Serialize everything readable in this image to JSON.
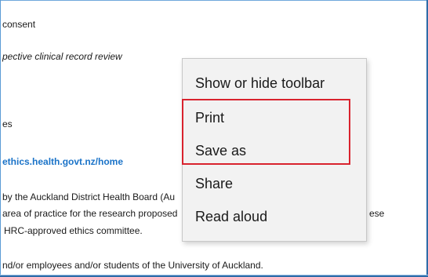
{
  "document": {
    "lines": [
      "consent",
      "pective clinical record review",
      "es",
      "ethics.health.govt.nz/home",
      "by the Auckland District Health Board (Au",
      "area of practice for the research proposed",
      "ese",
      "HRC-approved ethics committee.",
      "nd/or employees and/or students of the University of Auckland."
    ]
  },
  "context_menu": {
    "items": [
      {
        "label": "Show or hide toolbar"
      },
      {
        "label": "Print"
      },
      {
        "label": "Save as"
      },
      {
        "label": "Share"
      },
      {
        "label": "Read aloud"
      }
    ]
  },
  "colors": {
    "highlight": "#d9232e",
    "link": "#1a73c8",
    "menu_background": "#f2f2f2"
  }
}
